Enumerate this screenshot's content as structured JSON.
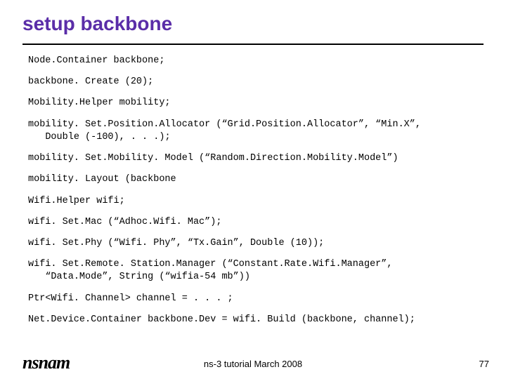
{
  "title": "setup backbone",
  "lines": [
    "Node.Container backbone;",
    "backbone. Create (20);",
    "Mobility.Helper mobility;",
    "mobility. Set.Position.Allocator (“Grid.Position.Allocator”, “Min.X”,\n   Double (-100), . . .);",
    "mobility. Set.Mobility. Model (“Random.Direction.Mobility.Model”)",
    "mobility. Layout (backbone",
    "Wifi.Helper wifi;",
    "wifi. Set.Mac (“Adhoc.Wifi. Mac”);",
    "wifi. Set.Phy (“Wifi. Phy”, “Tx.Gain”, Double (10));",
    "wifi. Set.Remote. Station.Manager (“Constant.Rate.Wifi.Manager”,\n   “Data.Mode”, String (“wifia-54 mb”))",
    "Ptr<Wifi. Channel> channel = . . . ;",
    "Net.Device.Container backbone.Dev = wifi. Build (backbone, channel);"
  ],
  "footer": "ns-3 tutorial March 2008",
  "page": "77",
  "logo": "nsnam"
}
